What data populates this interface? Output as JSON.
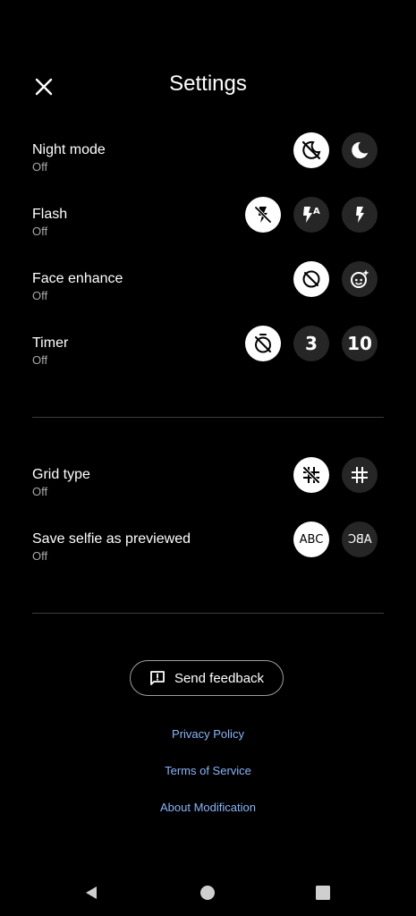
{
  "header": {
    "title": "Settings",
    "close_icon": "close-icon"
  },
  "settings": [
    {
      "label": "Night mode",
      "value": "Off",
      "options": [
        {
          "icon": "night-mode-off-icon",
          "selected": true
        },
        {
          "icon": "night-mode-on-icon",
          "selected": false
        }
      ]
    },
    {
      "label": "Flash",
      "value": "Off",
      "options": [
        {
          "icon": "flash-off-icon",
          "selected": true
        },
        {
          "icon": "flash-auto-icon",
          "text": "A",
          "selected": false
        },
        {
          "icon": "flash-on-icon",
          "selected": false
        }
      ]
    },
    {
      "label": "Face enhance",
      "value": "Off",
      "options": [
        {
          "icon": "face-enhance-off-icon",
          "selected": true
        },
        {
          "icon": "face-enhance-on-icon",
          "selected": false
        }
      ]
    },
    {
      "label": "Timer",
      "value": "Off",
      "options": [
        {
          "icon": "timer-off-icon",
          "selected": true
        },
        {
          "icon": "timer-3-icon",
          "text": "3",
          "selected": false
        },
        {
          "icon": "timer-10-icon",
          "text": "10",
          "selected": false
        }
      ]
    },
    {
      "label": "Grid type",
      "value": "Off",
      "options": [
        {
          "icon": "grid-off-icon",
          "selected": true
        },
        {
          "icon": "grid-on-icon",
          "selected": false
        }
      ]
    },
    {
      "label": "Save selfie as previewed",
      "value": "Off",
      "options": [
        {
          "icon": "selfie-normal-icon",
          "text": "ABC",
          "selected": true
        },
        {
          "icon": "selfie-mirrored-icon",
          "text": "ABC",
          "selected": false
        }
      ]
    }
  ],
  "feedback": {
    "label": "Send feedback",
    "icon": "feedback-icon"
  },
  "links": {
    "privacy": "Privacy Policy",
    "terms": "Terms of Service",
    "about": "About Modification"
  },
  "nav": {
    "back_icon": "back-icon",
    "home_icon": "home-icon",
    "recents_icon": "recents-icon"
  },
  "colors": {
    "background": "#000000",
    "link": "#8ab4f8",
    "selected_bg": "#ffffff",
    "unselected_bg": "#262626"
  }
}
